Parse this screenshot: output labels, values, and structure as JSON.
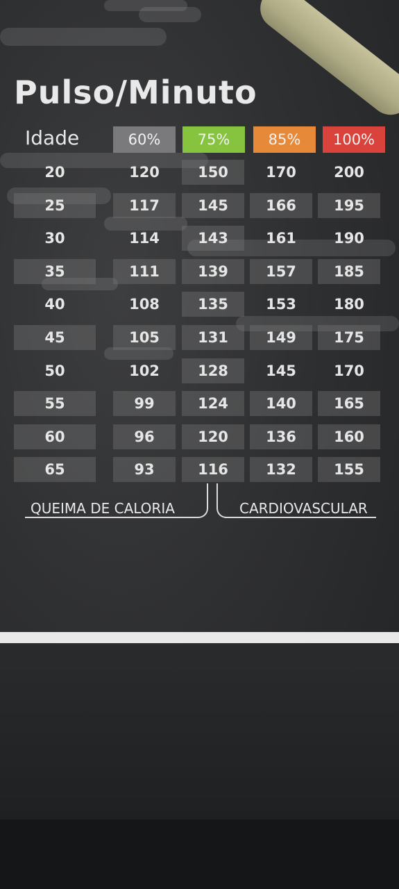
{
  "title": "Pulso/Minuto",
  "age_header": "Idade",
  "zones": [
    {
      "label": "60%",
      "color": "#7a7a7c"
    },
    {
      "label": "75%",
      "color": "#86c440"
    },
    {
      "label": "85%",
      "color": "#e68a3a"
    },
    {
      "label": "100%",
      "color": "#d9433b"
    }
  ],
  "rows": [
    {
      "age": "20",
      "values": [
        "120",
        "150",
        "170",
        "200"
      ]
    },
    {
      "age": "25",
      "values": [
        "117",
        "145",
        "166",
        "195"
      ]
    },
    {
      "age": "30",
      "values": [
        "114",
        "143",
        "161",
        "190"
      ]
    },
    {
      "age": "35",
      "values": [
        "111",
        "139",
        "157",
        "185"
      ]
    },
    {
      "age": "40",
      "values": [
        "108",
        "135",
        "153",
        "180"
      ]
    },
    {
      "age": "45",
      "values": [
        "105",
        "131",
        "149",
        "175"
      ]
    },
    {
      "age": "50",
      "values": [
        "102",
        "128",
        "145",
        "170"
      ]
    },
    {
      "age": "55",
      "values": [
        "99",
        "124",
        "140",
        "165"
      ]
    },
    {
      "age": "60",
      "values": [
        "96",
        "120",
        "136",
        "160"
      ]
    },
    {
      "age": "65",
      "values": [
        "93",
        "116",
        "132",
        "155"
      ]
    }
  ],
  "footer": {
    "left": "QUEIMA DE CALORIA",
    "right": "CARDIOVASCULAR"
  }
}
